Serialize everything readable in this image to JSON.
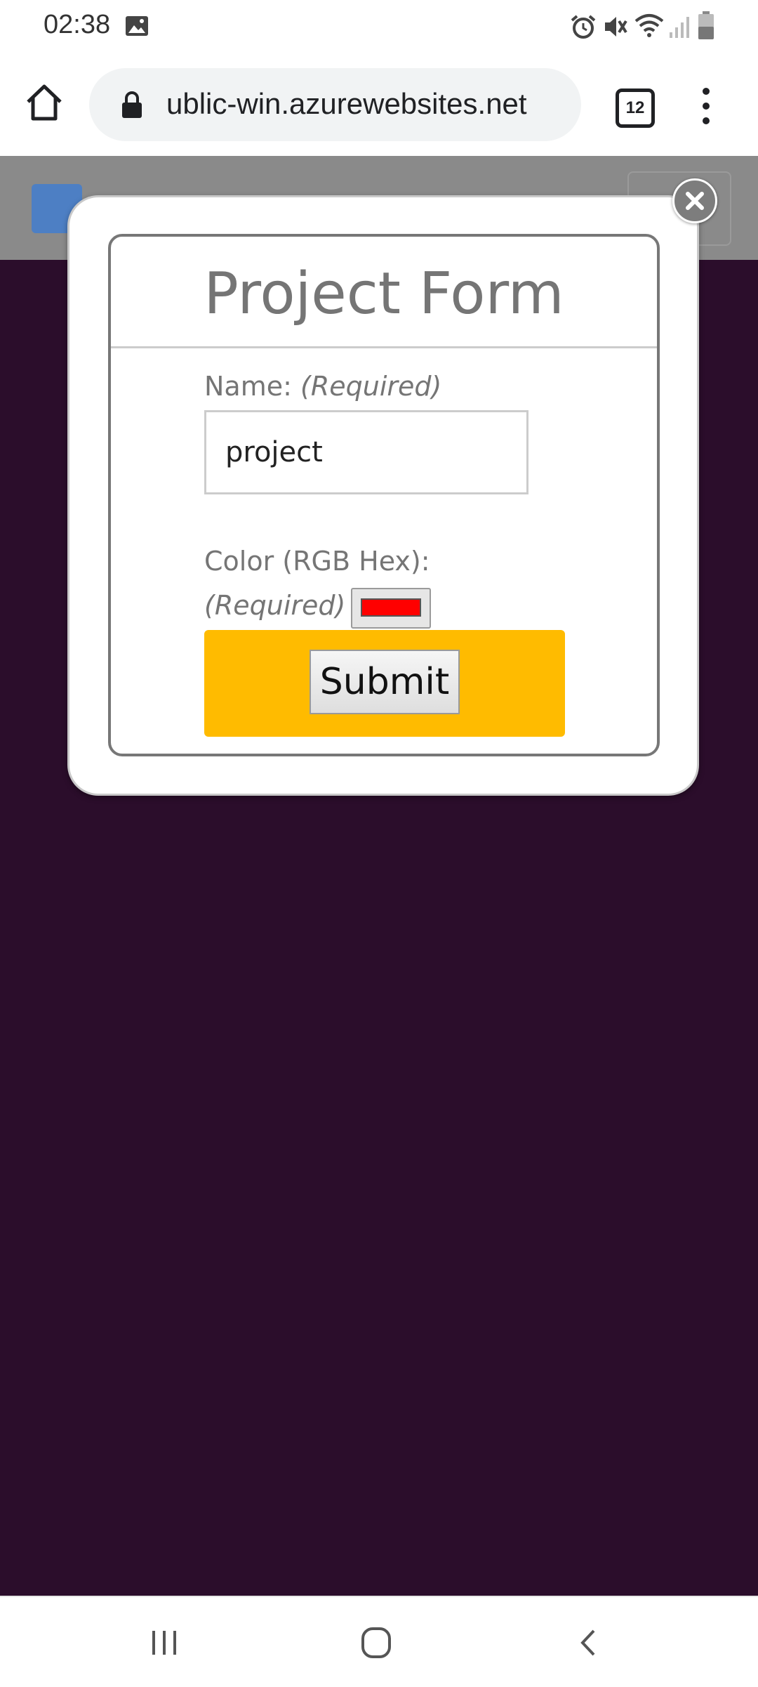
{
  "status_bar": {
    "time": "02:38",
    "icons": [
      "image-icon",
      "alarm-icon",
      "mute-icon",
      "wifi-icon",
      "signal-icon",
      "battery-icon"
    ]
  },
  "browser": {
    "url": "ublic-win.azurewebsites.net",
    "tab_count": "12",
    "icons": [
      "home-icon",
      "lock-icon",
      "tabs-icon",
      "more-vert-icon"
    ]
  },
  "modal": {
    "title": "Project Form",
    "name_label": "Name:",
    "name_required": "(Required)",
    "name_value": "project",
    "color_label": "Color (RGB Hex):",
    "color_required": "(Required)",
    "color_value": "#ff0000",
    "submit_label": "Submit"
  },
  "colors": {
    "page_background": "#2b0d2b",
    "submit_area": "#ffbb00",
    "swatch": "#ff0000"
  },
  "nav_bar": {
    "icons": [
      "recents-icon",
      "home-circle-icon",
      "back-icon"
    ]
  }
}
